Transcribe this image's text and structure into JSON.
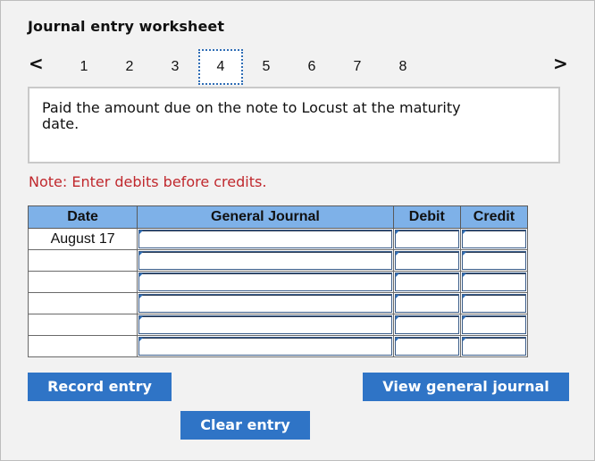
{
  "worksheet": {
    "title": "Journal entry worksheet",
    "nav": {
      "prev_glyph": "<",
      "next_glyph": ">"
    },
    "steps": [
      "1",
      "2",
      "3",
      "4",
      "5",
      "6",
      "7",
      "8"
    ],
    "active_step": "4",
    "prompt": "Paid the amount due on the note to Locust at the maturity date.",
    "note": "Note: Enter debits before credits."
  },
  "table": {
    "headers": {
      "date": "Date",
      "general_journal": "General Journal",
      "debit": "Debit",
      "credit": "Credit"
    },
    "rows": [
      {
        "date": "August 17"
      },
      {
        "date": ""
      },
      {
        "date": ""
      },
      {
        "date": ""
      },
      {
        "date": ""
      },
      {
        "date": ""
      }
    ]
  },
  "buttons": {
    "record": "Record entry",
    "clear": "Clear entry",
    "view_journal": "View general journal"
  },
  "colors": {
    "accent": "#2f74c6",
    "header_bg": "#7eb1e8",
    "note": "#c0282d",
    "panel_bg": "#f2f2f2"
  }
}
